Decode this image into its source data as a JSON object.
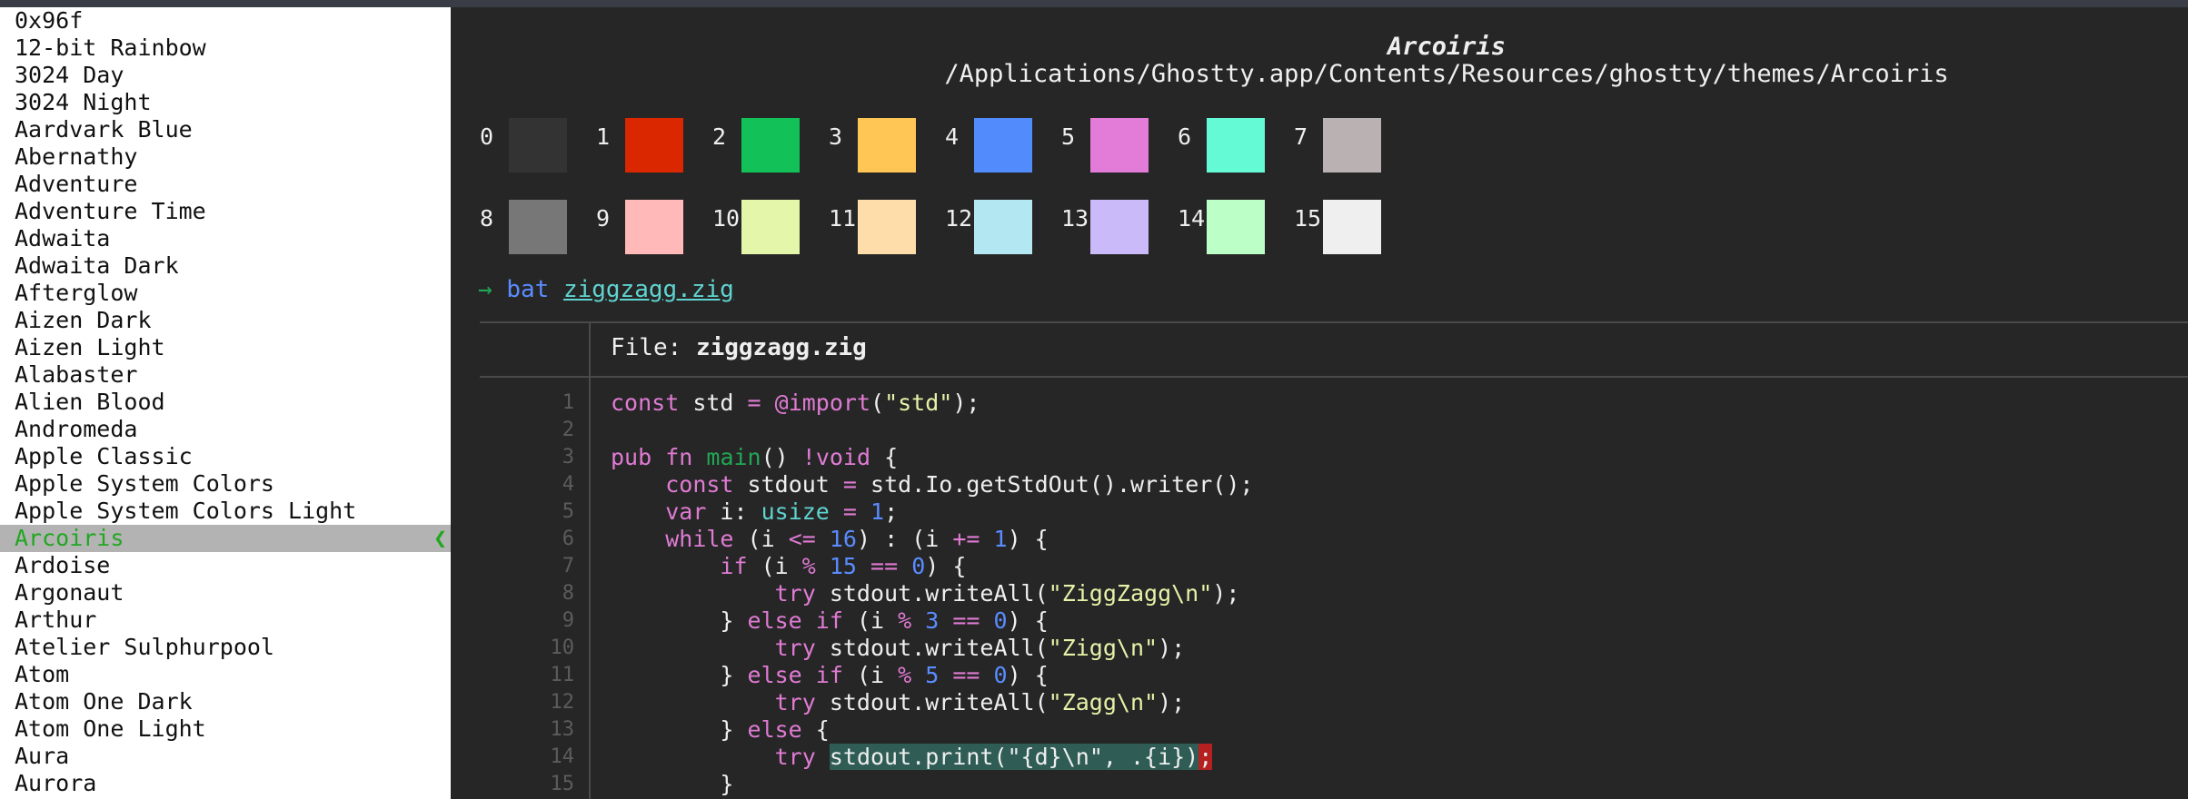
{
  "sidebar": {
    "themes": [
      "0x96f",
      "12-bit Rainbow",
      "3024 Day",
      "3024 Night",
      "Aardvark Blue",
      "Abernathy",
      "Adventure",
      "Adventure Time",
      "Adwaita",
      "Adwaita Dark",
      "Afterglow",
      "Aizen Dark",
      "Aizen Light",
      "Alabaster",
      "Alien Blood",
      "Andromeda",
      "Apple Classic",
      "Apple System Colors",
      "Apple System Colors Light",
      "Arcoiris",
      "Ardoise",
      "Argonaut",
      "Arthur",
      "Atelier Sulphurpool",
      "Atom",
      "Atom One Dark",
      "Atom One Light",
      "Aura",
      "Aurora"
    ],
    "selected_index": 19,
    "selected_marker": "❮"
  },
  "preview": {
    "theme_name": "Arcoiris",
    "theme_path": "/Applications/Ghostty.app/Contents/Resources/ghostty/themes/Arcoiris",
    "palette": [
      {
        "index": "0",
        "color": "#333333"
      },
      {
        "index": "1",
        "color": "#da2700"
      },
      {
        "index": "2",
        "color": "#12c258"
      },
      {
        "index": "3",
        "color": "#ffc656"
      },
      {
        "index": "4",
        "color": "#518bfc"
      },
      {
        "index": "5",
        "color": "#e37bd9"
      },
      {
        "index": "6",
        "color": "#63fad5"
      },
      {
        "index": "7",
        "color": "#bab2b2"
      },
      {
        "index": "8",
        "color": "#777777"
      },
      {
        "index": "9",
        "color": "#ffb9b9"
      },
      {
        "index": "10",
        "color": "#e3f6aa"
      },
      {
        "index": "11",
        "color": "#ffddaa"
      },
      {
        "index": "12",
        "color": "#b3e8f3"
      },
      {
        "index": "13",
        "color": "#cbbaf9"
      },
      {
        "index": "14",
        "color": "#bcffc7"
      },
      {
        "index": "15",
        "color": "#efefef"
      }
    ],
    "prompt": {
      "arrow": "→",
      "command": "bat",
      "argument": "ziggzagg.zig"
    },
    "file_label": "File:",
    "file_name": "ziggzagg.zig",
    "line_numbers": [
      "1",
      "2",
      "3",
      "4",
      "5",
      "6",
      "7",
      "8",
      "9",
      "10",
      "11",
      "12",
      "13",
      "14",
      "15"
    ]
  },
  "colors": {
    "sidebar_bg": "#ffffff",
    "selected_bg": "#b3b3b3",
    "selected_text": "#22a722",
    "terminal_bg": "#262626",
    "foreground": "#efefef"
  }
}
